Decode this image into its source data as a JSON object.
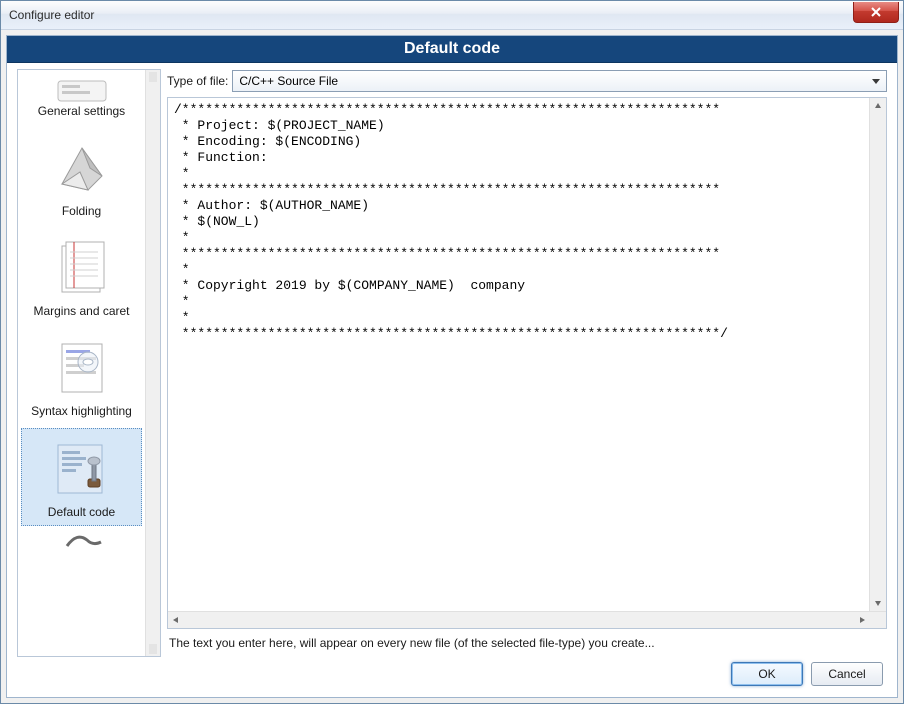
{
  "window": {
    "title": "Configure editor"
  },
  "banner": "Default code",
  "filetype": {
    "label": "Type of file:",
    "value": "C/C++ Source File"
  },
  "sidebar": {
    "items": [
      {
        "label": "General settings"
      },
      {
        "label": "Folding"
      },
      {
        "label": "Margins and caret"
      },
      {
        "label": "Syntax highlighting"
      },
      {
        "label": "Default code"
      }
    ]
  },
  "editor_text": "/*********************************************************************\n * Project: $(PROJECT_NAME)\n * Encoding: $(ENCODING)\n * Function:\n *\n *********************************************************************\n * Author: $(AUTHOR_NAME)\n * $(NOW_L)\n *\n *********************************************************************\n *\n * Copyright 2019 by $(COMPANY_NAME)  company\n *\n *\n *********************************************************************/",
  "hint": "The text you enter here, will appear on every new file (of the selected file-type) you create...",
  "buttons": {
    "ok": "OK",
    "cancel": "Cancel"
  }
}
